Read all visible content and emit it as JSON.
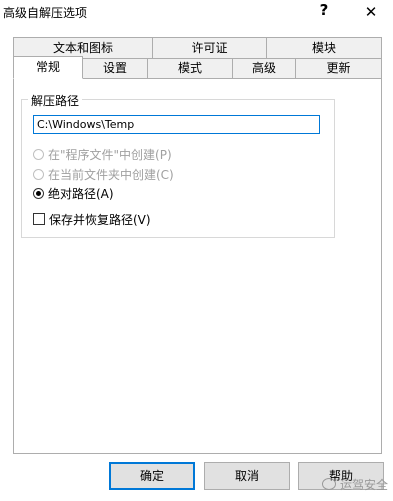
{
  "window": {
    "title": "高级自解压选项",
    "help": "?",
    "close": "✕"
  },
  "tabs_back": [
    {
      "label": "文本和图标"
    },
    {
      "label": "许可证"
    },
    {
      "label": "模块"
    }
  ],
  "tabs_front": [
    {
      "label": "常规",
      "active": true
    },
    {
      "label": "设置"
    },
    {
      "label": "模式"
    },
    {
      "label": "高级"
    },
    {
      "label": "更新"
    }
  ],
  "extract_path": {
    "group_label": "解压路径",
    "value": "C:\\Windows\\Temp",
    "options": [
      {
        "label": "在\"程序文件\"中创建(P)",
        "checked": false,
        "disabled": true
      },
      {
        "label": "在当前文件夹中创建(C)",
        "checked": false,
        "disabled": true
      },
      {
        "label": "绝对路径(A)",
        "checked": true,
        "disabled": false
      }
    ],
    "save_restore": {
      "label": "保存并恢复路径(V)",
      "checked": false
    }
  },
  "buttons": {
    "ok": "确定",
    "cancel": "取消",
    "help": "帮助"
  },
  "watermark": {
    "text": "运驾安全"
  },
  "colors": {
    "focus_border": "#0078d7",
    "button_bg": "#e1e1e1",
    "tab_bg": "#f0f0f0",
    "disabled_text": "#a0a0a0"
  }
}
